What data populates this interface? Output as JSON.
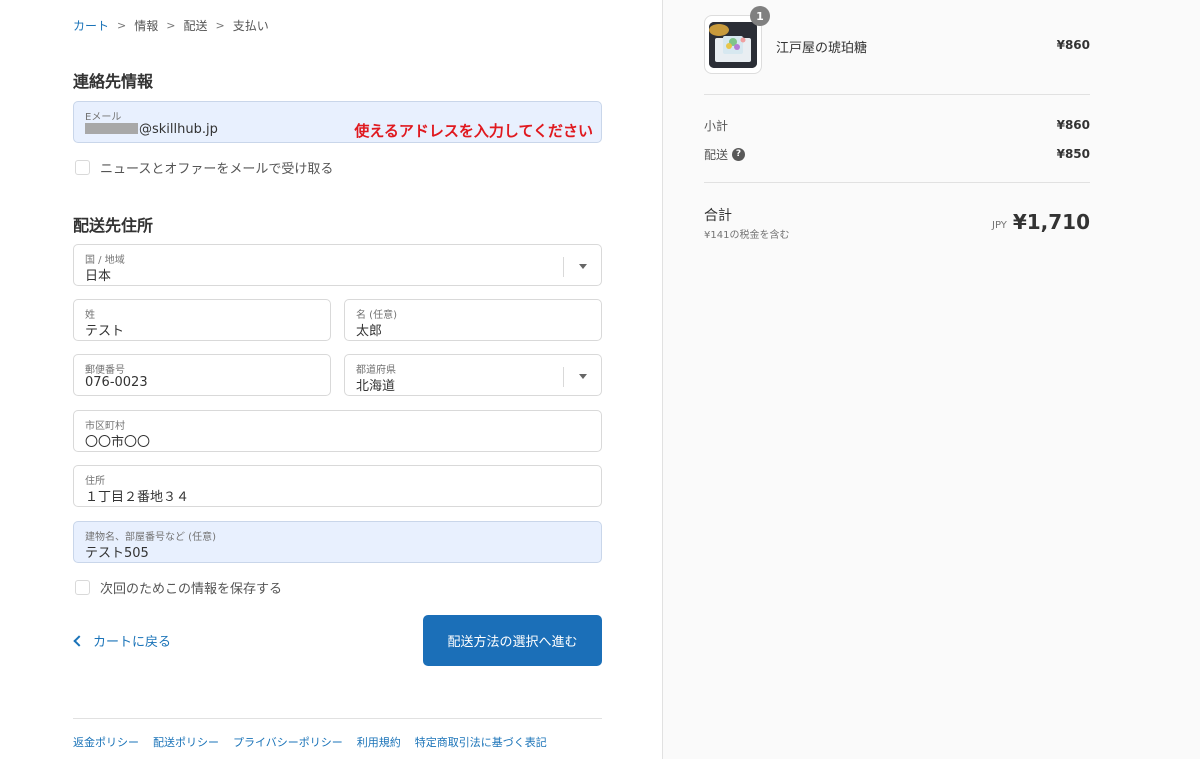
{
  "breadcrumb": {
    "items": [
      {
        "label": "カート"
      },
      {
        "label": "情報"
      },
      {
        "label": "配送"
      },
      {
        "label": "支払い"
      }
    ],
    "separator": ">"
  },
  "contact": {
    "title": "連絡先情報",
    "email_label": "Eメール",
    "email_value": "@skillhub.jp",
    "annotation": "使えるアドレスを入力してください",
    "newsletter_label": "ニュースとオファーをメールで受け取る"
  },
  "shipping": {
    "title": "配送先住所",
    "country_label": "国 / 地域",
    "country_value": "日本",
    "last_name_label": "姓",
    "last_name_value": "テスト",
    "first_name_label": "名 (任意)",
    "first_name_value": "太郎",
    "postal_label": "郵便番号",
    "postal_value": "076-0023",
    "prefecture_label": "都道府県",
    "prefecture_value": "北海道",
    "city_label": "市区町村",
    "city_value": "〇〇市〇〇",
    "address_label": "住所",
    "address_value": "１丁目２番地３４",
    "building_label": "建物名、部屋番号など (任意)",
    "building_value": "テスト505",
    "save_info_label": "次回のためこの情報を保存する"
  },
  "actions": {
    "back_label": "カートに戻る",
    "continue_label": "配送方法の選択へ進む"
  },
  "footer": {
    "links": [
      {
        "label": "返金ポリシー"
      },
      {
        "label": "配送ポリシー"
      },
      {
        "label": "プライバシーポリシー"
      },
      {
        "label": "利用規約"
      },
      {
        "label": "特定商取引法に基づく表記"
      }
    ]
  },
  "summary": {
    "product": {
      "name": "江戸屋の琥珀糖",
      "price": "¥860",
      "quantity": "1"
    },
    "subtotal_label": "小計",
    "subtotal_value": "¥860",
    "shipping_label": "配送",
    "shipping_value": "¥850",
    "total_label": "合計",
    "tax_note": "¥141の税金を含む",
    "currency": "JPY",
    "total_value": "¥1,710"
  },
  "colors": {
    "accent": "#1b6fb8",
    "link": "#1a73b8",
    "annotation": "#e0191f",
    "autofill_bg": "#e8f0fe"
  }
}
